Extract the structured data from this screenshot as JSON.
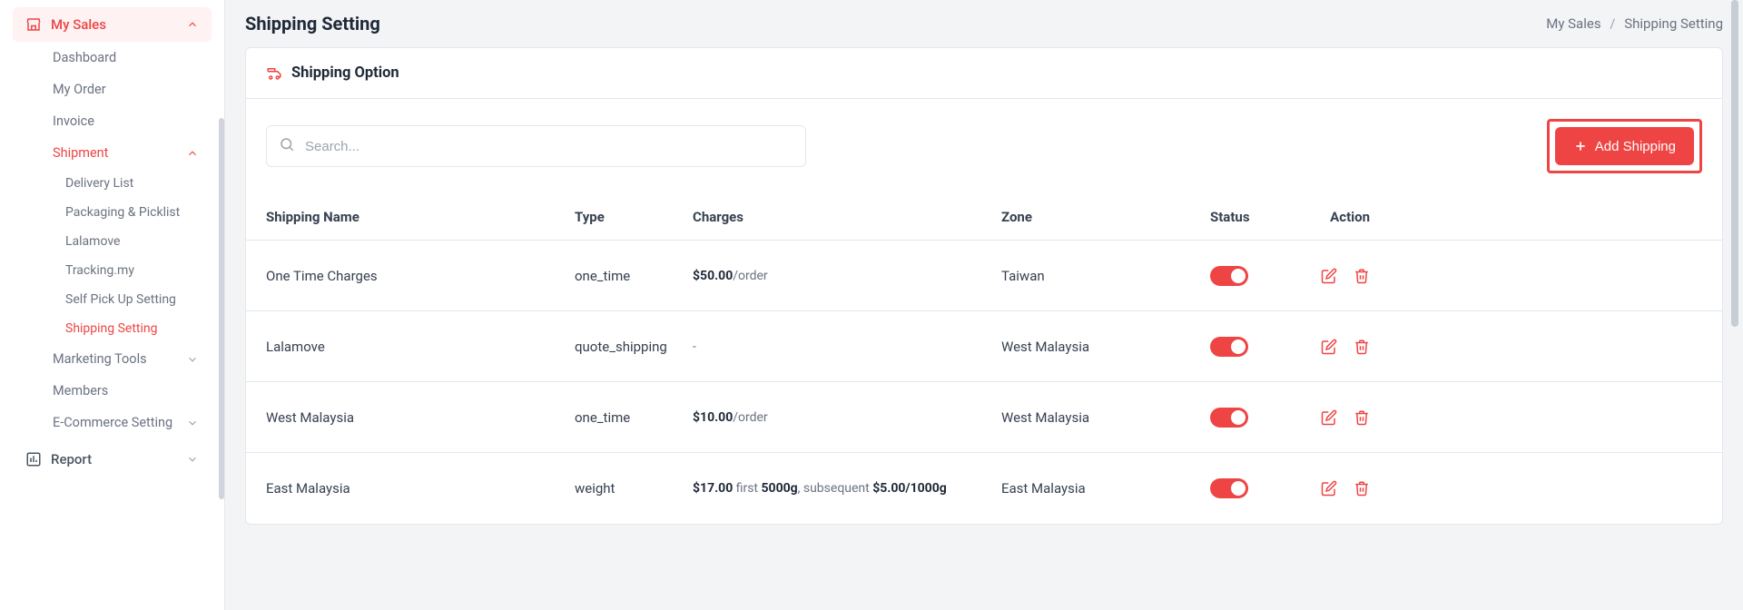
{
  "page": {
    "title": "Shipping Setting",
    "breadcrumb_root": "My Sales",
    "breadcrumb_current": "Shipping Setting"
  },
  "sidebar": {
    "group_my_sales": "My Sales",
    "item_dashboard": "Dashboard",
    "item_my_order": "My Order",
    "item_invoice": "Invoice",
    "sub_shipment": "Shipment",
    "sub_delivery_list": "Delivery List",
    "sub_packaging": "Packaging & Picklist",
    "sub_lalamove": "Lalamove",
    "sub_tracking": "Tracking.my",
    "sub_self_pickup": "Self Pick Up Setting",
    "sub_shipping_setting": "Shipping Setting",
    "item_marketing_tools": "Marketing Tools",
    "item_members": "Members",
    "item_ecommerce_setting": "E-Commerce Setting",
    "group_report": "Report"
  },
  "card": {
    "title": "Shipping Option",
    "search_placeholder": "Search...",
    "add_button": "Add Shipping"
  },
  "table": {
    "headers": {
      "name": "Shipping Name",
      "type": "Type",
      "charges": "Charges",
      "zone": "Zone",
      "status": "Status",
      "action": "Action"
    },
    "rows": [
      {
        "name": "One Time Charges",
        "type": "one_time",
        "charge_amount": "$50.00",
        "charge_suffix": "/order",
        "zone": "Taiwan",
        "status_on": true
      },
      {
        "name": "Lalamove",
        "type": "quote_shipping",
        "charge_raw": "-",
        "zone": "West Malaysia",
        "status_on": true
      },
      {
        "name": "West Malaysia",
        "type": "one_time",
        "charge_amount": "$10.00",
        "charge_suffix": "/order",
        "zone": "West Malaysia",
        "status_on": true
      },
      {
        "name": "East Malaysia",
        "type": "weight",
        "charge_weight": {
          "first_amount": "$17.00",
          "first_label": " first ",
          "first_unit": "5000g",
          "subsequent_label": ", subsequent ",
          "subsequent_amount": "$5.00/1000g"
        },
        "zone": "East Malaysia",
        "status_on": true
      }
    ]
  }
}
